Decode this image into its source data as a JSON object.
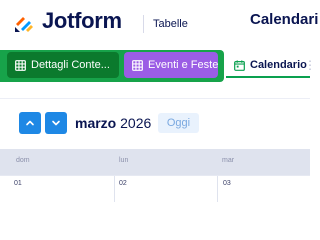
{
  "header": {
    "brand": "Jotform",
    "section": "Tabelle",
    "app_title": "Calendari"
  },
  "tabs": [
    {
      "label": "Dettagli Conte...",
      "icon": "table-icon",
      "color": "#0b7a2d"
    },
    {
      "label": "Eventi e Feste",
      "icon": "table-icon",
      "color": "#9b5de5"
    },
    {
      "label": "Calendario",
      "icon": "calendar-icon",
      "active": true
    }
  ],
  "toolbar": {
    "month": "marzo",
    "year": "2026",
    "today_label": "Oggi"
  },
  "calendar": {
    "weekdays": [
      "dom",
      "lun",
      "mar"
    ],
    "days": [
      "01",
      "02",
      "03"
    ]
  },
  "colors": {
    "tab_group_bg": "#17a34a",
    "accent_blue": "#1e88e5",
    "text_primary": "#0a1551"
  }
}
